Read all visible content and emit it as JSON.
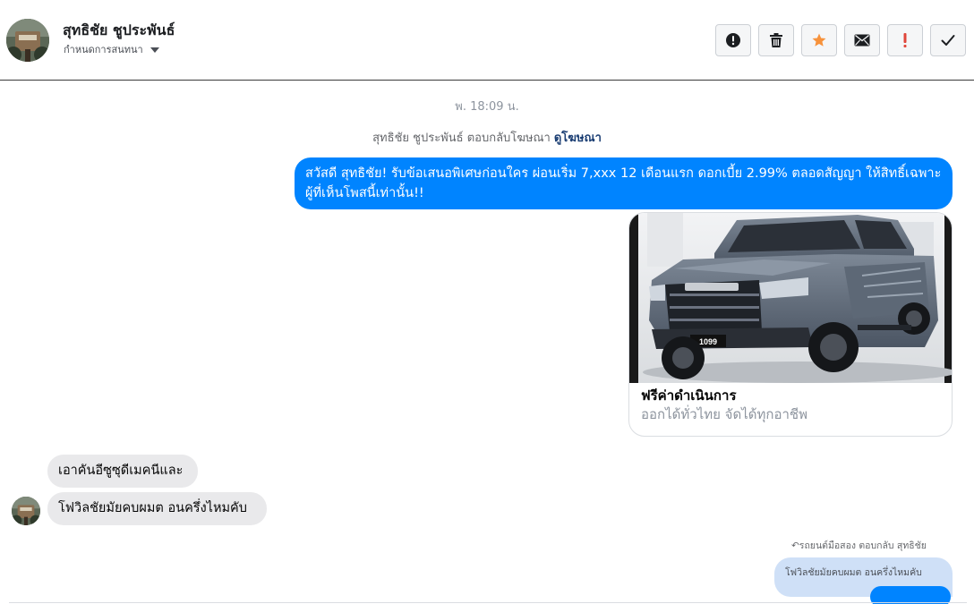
{
  "header": {
    "contact_name": "สุทธิชัย ชูประพันธ์",
    "subtitle": "กำหนดการสนทนา",
    "actions": [
      {
        "name": "report-spam",
        "icon": "exclamation-circle-icon"
      },
      {
        "name": "delete",
        "icon": "trash-icon"
      },
      {
        "name": "star",
        "icon": "star-icon",
        "color": "#f7923b"
      },
      {
        "name": "mark-unread",
        "icon": "envelope-icon"
      },
      {
        "name": "follow-up",
        "icon": "exclamation-icon",
        "color": "#e0453a"
      },
      {
        "name": "mark-done",
        "icon": "checkmark-icon"
      }
    ]
  },
  "conversation": {
    "timestamp": "พ. 18:09 น.",
    "ad_reply_text": "สุทธิชัย ชูประพันธ์ ตอบกลับโฆษณา",
    "ad_reply_link": "ดูโฆษณา",
    "outgoing_message": "สวัสดี สุทธิชัย! รับข้อเสนอพิเศษก่อนใคร ผ่อนเริ่ม 7,xxx 12 เดือนแรก ดอกเบี้ย 2.99% ตลอดสัญญา ให้สิทธิ์เฉพาะผู้ที่เห็นโพสนี้เท่านั้น!!",
    "ad_card": {
      "title": "ฟรีค่าดำเนินการ",
      "description": "ออกได้ทั่วไทย จัดได้ทุกอาชีพ",
      "image": "pickup-truck-photo",
      "plate": "1099"
    },
    "incoming_messages": [
      "เอาคันอีซูซุดีเมคนีและ",
      "โฟวิลชัยมัยคบผมต อนครึ่งไหมคับ"
    ],
    "reply_note": "↶รถยนต์มือสอง ตอบกลับ สุทธิชัย",
    "quoted_message": "โฟวิลชัยมัยคบผมต อนครึ่งไหมคับ"
  },
  "colors": {
    "messenger_blue": "#0084ff",
    "incoming_bubble": "#e9e9eb",
    "muted_text": "#8d949e"
  }
}
